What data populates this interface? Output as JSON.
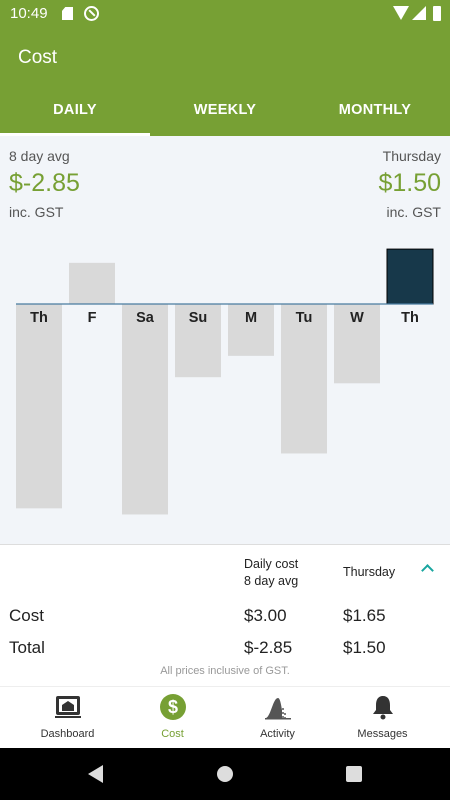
{
  "status_bar": {
    "time": "10:49"
  },
  "app_bar": {
    "title": "Cost"
  },
  "tabs": [
    {
      "label": "DAILY",
      "active": true
    },
    {
      "label": "WEEKLY",
      "active": false
    },
    {
      "label": "MONTHLY",
      "active": false
    }
  ],
  "summary_header": {
    "avg_label": "8 day avg",
    "avg_value": "$-2.85",
    "avg_gst": "inc. GST",
    "day_label": "Thursday",
    "day_value": "$1.50",
    "day_gst": "inc. GST"
  },
  "chart_data": {
    "type": "bar",
    "categories": [
      "Th",
      "F",
      "Sa",
      "Su",
      "M",
      "Tu",
      "W",
      "Th"
    ],
    "values": [
      -6.7,
      1.35,
      -6.9,
      -2.4,
      -1.7,
      -4.9,
      -2.6,
      1.8
    ],
    "selected_index": 7,
    "colors": {
      "bar": "#d9d9d9",
      "selected": "#17384a",
      "baseline": "#4a7ca0",
      "accent": "#77a034"
    }
  },
  "table": {
    "col1_header": [
      "Daily cost",
      "8 day avg"
    ],
    "col2_header": "Thursday",
    "rows": [
      {
        "label": "Cost",
        "avg": "$3.00",
        "day": "$1.65"
      },
      {
        "label": "Total",
        "avg": "$-2.85",
        "day": "$1.50"
      }
    ],
    "footnote": "All prices inclusive of GST."
  },
  "bottom_nav": [
    {
      "label": "Dashboard",
      "icon": "dashboard-icon"
    },
    {
      "label": "Cost",
      "icon": "dollar-icon",
      "active": true
    },
    {
      "label": "Activity",
      "icon": "activity-icon"
    },
    {
      "label": "Messages",
      "icon": "bell-icon"
    }
  ]
}
